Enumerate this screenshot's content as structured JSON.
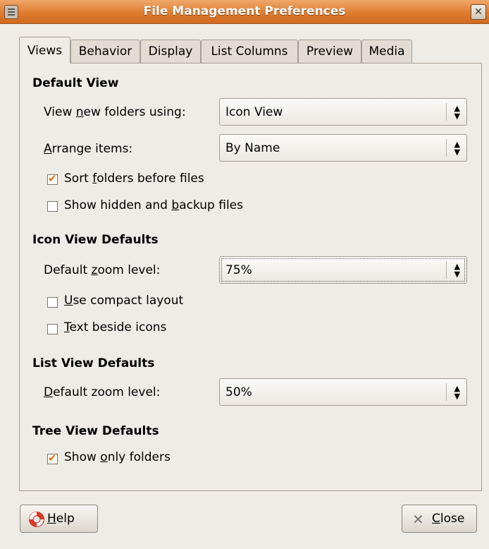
{
  "window": {
    "title": "File Management Preferences"
  },
  "tabs": [
    "Views",
    "Behavior",
    "Display",
    "List Columns",
    "Preview",
    "Media"
  ],
  "default_view": {
    "heading": "Default View",
    "view_new_label_pre": "View ",
    "view_new_label_key": "n",
    "view_new_label_post": "ew folders using:",
    "view_new_value": "Icon View",
    "arrange_label_key": "A",
    "arrange_label_post": "rrange items:",
    "arrange_value": "By Name",
    "sort_folders_pre": "Sort ",
    "sort_folders_key": "f",
    "sort_folders_post": "olders before files",
    "sort_folders_checked": true,
    "show_hidden_pre": "Show hidden and ",
    "show_hidden_key": "b",
    "show_hidden_post": "ackup files",
    "show_hidden_checked": false
  },
  "icon_view": {
    "heading": "Icon View Defaults",
    "zoom_label_pre": "Default ",
    "zoom_label_key": "z",
    "zoom_label_post": "oom level:",
    "zoom_value": "75%",
    "compact_key": "U",
    "compact_post": "se compact layout",
    "compact_checked": false,
    "text_beside_key": "T",
    "text_beside_post": "ext beside icons",
    "text_beside_checked": false
  },
  "list_view": {
    "heading": "List View Defaults",
    "zoom_label_key": "D",
    "zoom_label_post": "efault zoom level:",
    "zoom_value": "50%"
  },
  "tree_view": {
    "heading": "Tree View Defaults",
    "only_folders_pre": "Show ",
    "only_folders_key": "o",
    "only_folders_post": "nly folders",
    "only_folders_checked": true
  },
  "buttons": {
    "help_key": "H",
    "help_post": "elp",
    "close_key": "C",
    "close_post": "lose"
  }
}
